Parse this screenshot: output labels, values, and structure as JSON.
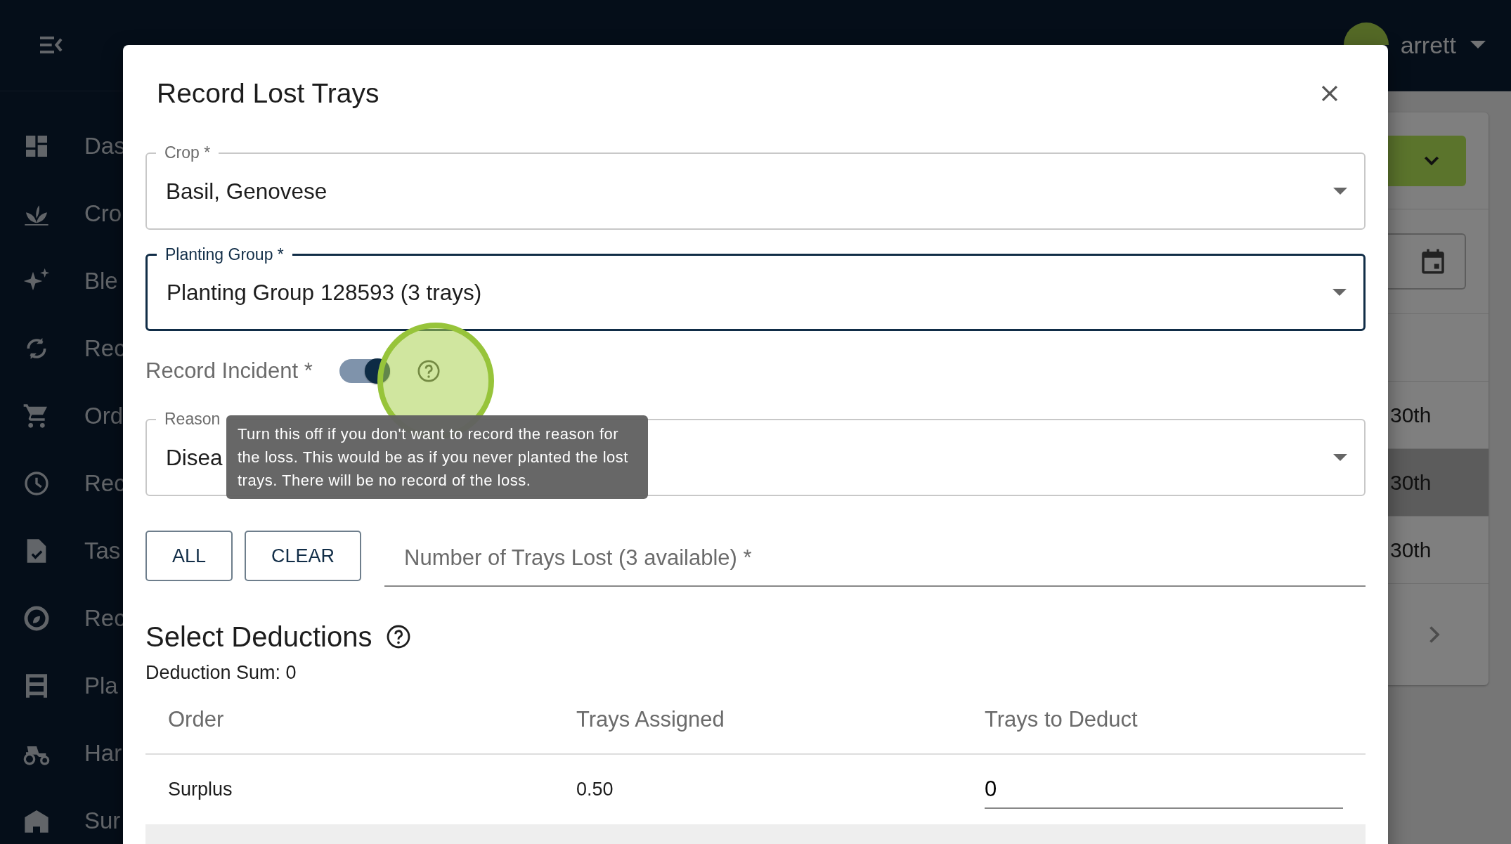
{
  "app_bar": {
    "user": "arrett"
  },
  "sidebar": {
    "items": [
      {
        "label": "Das"
      },
      {
        "label": "Cro"
      },
      {
        "label": "Ble"
      },
      {
        "label": "Rec"
      },
      {
        "label": "Ord"
      },
      {
        "label": "Rec"
      },
      {
        "label": "Tas"
      },
      {
        "label": "Rec"
      },
      {
        "label": "Pla"
      },
      {
        "label": "Har"
      },
      {
        "label": "Sur"
      }
    ]
  },
  "background_list": {
    "rows": [
      {
        "text": "30th",
        "highlighted": false
      },
      {
        "text": "30th",
        "highlighted": true
      },
      {
        "text": "30th",
        "highlighted": false
      }
    ]
  },
  "dialog": {
    "title": "Record Lost Trays",
    "fields": [
      {
        "label": "Crop *",
        "value": "Basil, Genovese",
        "focused": false
      },
      {
        "label": "Planting Group *",
        "value": "Planting Group 128593 (3 trays)",
        "focused": true
      }
    ],
    "record_incident": {
      "label": "Record Incident *",
      "on": true
    },
    "tooltip": "Turn this off if you don't want to record the reason for the loss. This would be as if you never planted the lost trays. There will be no record of the loss.",
    "reason": {
      "label": "Reason",
      "value": "Disea"
    },
    "buttons": [
      "ALL",
      "CLEAR"
    ],
    "trays_lost": {
      "placeholder": "Number of Trays Lost (3 available) *"
    },
    "deductions": {
      "title": "Select Deductions",
      "sum": "Deduction Sum: 0",
      "columns": [
        "Order",
        "Trays Assigned",
        "Trays to Deduct"
      ],
      "rows": [
        {
          "order": "Surplus",
          "assigned": "0.50",
          "deduct": "0"
        }
      ]
    }
  }
}
